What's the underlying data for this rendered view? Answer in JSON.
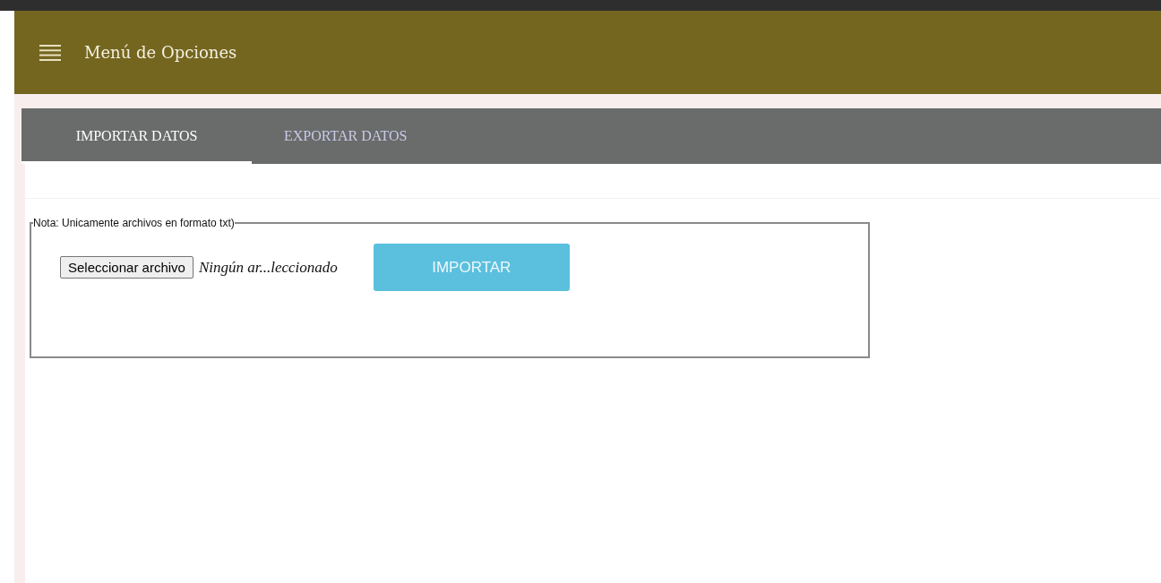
{
  "header": {
    "title": "Menú de Opciones"
  },
  "tabs": [
    {
      "label": "IMPORTAR DATOS",
      "selected": true
    },
    {
      "label": "EXPORTAR DATOS",
      "selected": false
    }
  ],
  "import_form": {
    "legend": "Nota: Unicamente archivos en formato txt)",
    "file_button": "Seleccionar archivo",
    "file_status": "Ningún ar...leccionado",
    "submit_button": "IMPORTAR"
  }
}
